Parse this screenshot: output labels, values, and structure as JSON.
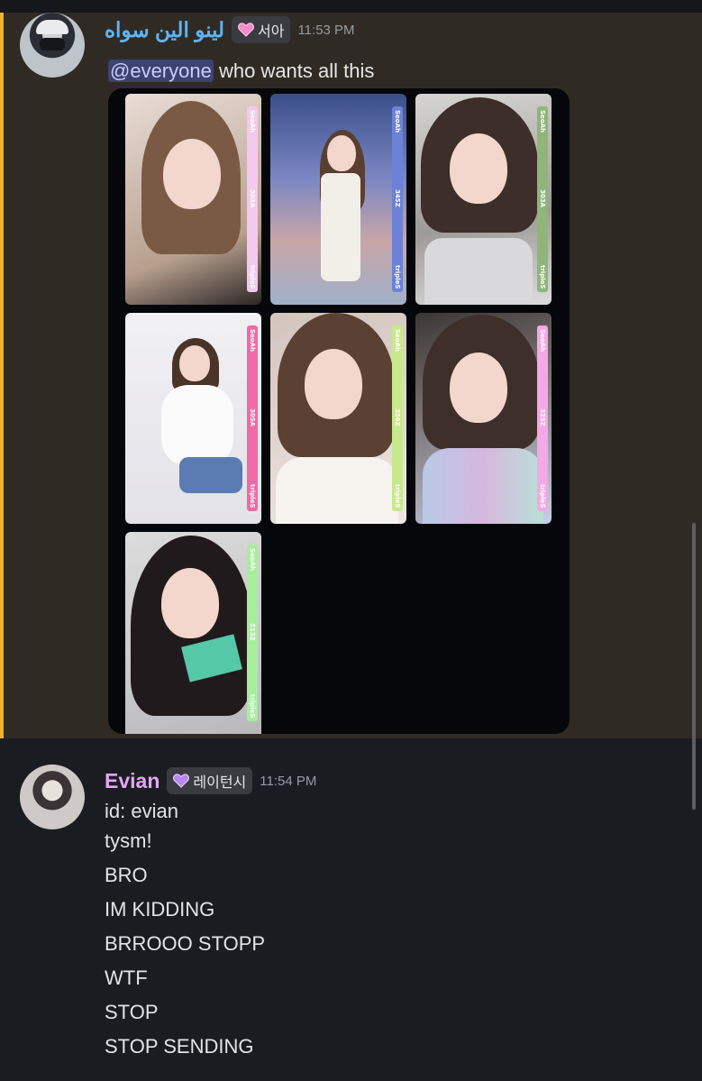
{
  "message1": {
    "username": "لينو الين سواه",
    "role": "서아",
    "timestamp": "11:53 PM",
    "mention": "@everyone",
    "text": " who wants all this",
    "cards": [
      {
        "member": "SeoAh",
        "code": "302A",
        "label": "tripleS",
        "color": "#f3c9ee"
      },
      {
        "member": "SeoAh",
        "code": "345Z",
        "label": "tripleS",
        "color": "#6d82d6"
      },
      {
        "member": "SeoAh",
        "code": "303A",
        "label": "tripleS",
        "color": "#8fb57a"
      },
      {
        "member": "SeoAh",
        "code": "305A",
        "label": "tripleS",
        "color": "#ef6aa7"
      },
      {
        "member": "SeoAh",
        "code": "356Z",
        "label": "tripleS",
        "color": "#c8e88c"
      },
      {
        "member": "SeoAh",
        "code": "329Z",
        "label": "tripleS",
        "color": "#f4a8e6"
      },
      {
        "member": "SeoAh",
        "code": "313Z",
        "label": "tripleS",
        "color": "#a7ee9c"
      }
    ]
  },
  "message2": {
    "username": "Evian",
    "role": "레이턴시",
    "timestamp": "11:54 PM",
    "lines": [
      "id: evian",
      "tysm!",
      "BRO",
      "IM KIDDING",
      "BRROOO STOPP",
      "WTF",
      "STOP",
      "STOP SENDING"
    ]
  },
  "colors": {
    "accent_bar": "#f0b232",
    "username1": "#5fb3f5",
    "username2": "#e2a7f3",
    "mention_bg": "#3d4270"
  },
  "icons": [
    "pink-heart-icon",
    "purple-heart-icon"
  ]
}
